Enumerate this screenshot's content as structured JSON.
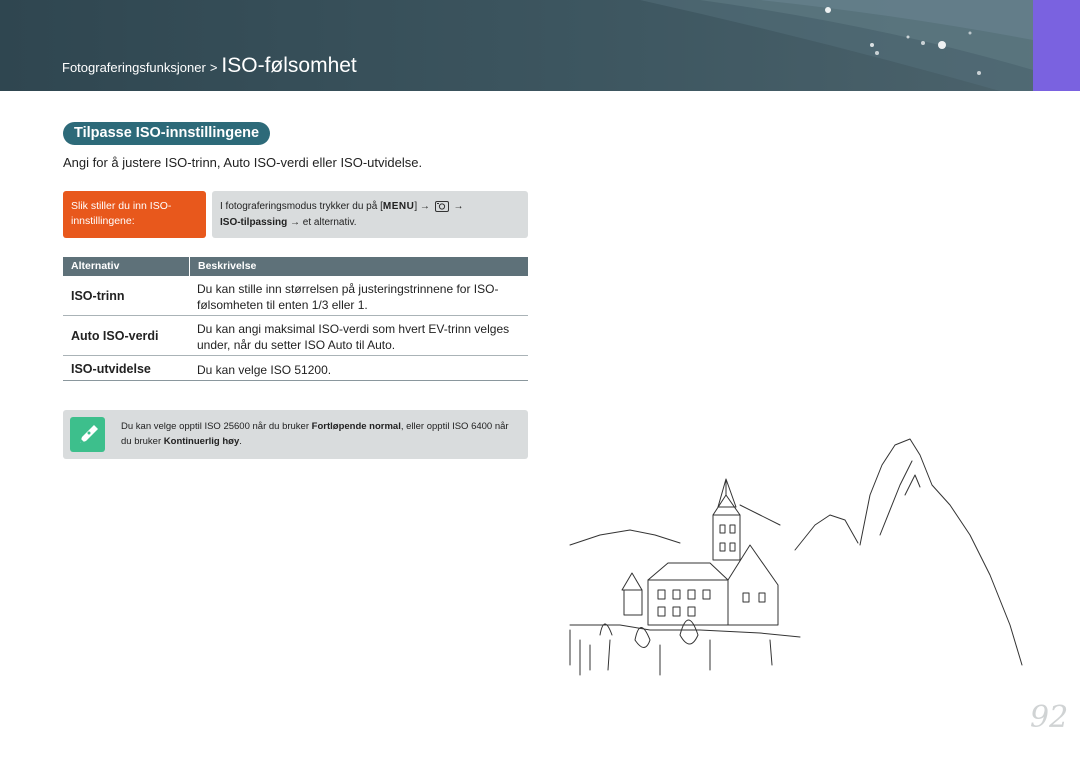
{
  "header": {
    "parent": "Fotograferingsfunksjoner",
    "separator": ">",
    "current": "ISO-følsomhet",
    "accent_color": "#7a62e0"
  },
  "section": {
    "title": "Tilpasse ISO-innstillingene",
    "intro": "Angi for å justere ISO-trinn, Auto ISO-verdi eller ISO-utvidelse."
  },
  "howto": {
    "label": "Slik stiller du inn ISO-innstillingene:",
    "text_start": "I fotograferingsmodus trykker du på [",
    "menu_key": "MENU",
    "text_mid": "] →",
    "icon": "camera-icon",
    "arrow": "→",
    "item": "ISO-tilpassing",
    "text_end": "→ et alternativ."
  },
  "table": {
    "headers": [
      "Alternativ",
      "Beskrivelse"
    ],
    "rows": [
      {
        "option": "ISO-trinn",
        "description": "Du kan stille inn størrelsen på justeringstrinnene for ISO-følsomheten til enten 1/3 eller 1."
      },
      {
        "option": "Auto ISO-verdi",
        "description": "Du kan angi maksimal ISO-verdi som hvert EV-trinn velges under, når du setter ISO Auto til Auto."
      },
      {
        "option": "ISO-utvidelse",
        "description": "Du kan velge ISO 51200."
      }
    ]
  },
  "note": {
    "icon": "pen-note-icon",
    "text_1": "Du kan velge opptil ISO 25600 når du bruker ",
    "bold_1": "Fortløpende normal",
    "text_2": ", eller opptil ISO 6400 når du bruker ",
    "bold_2": "Kontinuerlig høy",
    "text_3": "."
  },
  "page_number": "92",
  "colors": {
    "section_title_bg": "#2d6a79",
    "howto_label_bg": "#e8581c",
    "note_icon_bg": "#3dbf8c"
  }
}
